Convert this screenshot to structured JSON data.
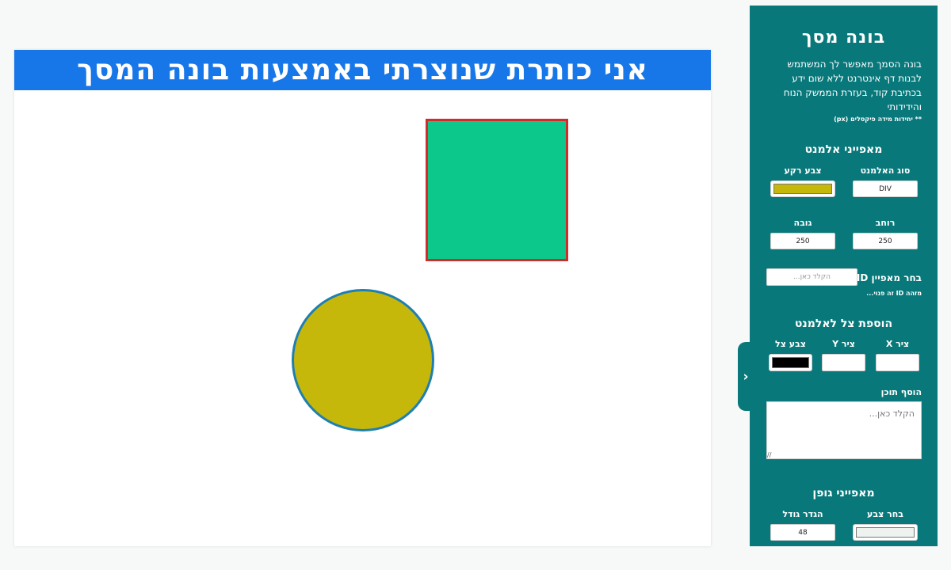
{
  "stage": {
    "title": "אני כותרת שנוצרתי באמצעות בונה המסך",
    "elements": [
      {
        "type": "square",
        "background": "#0cc98b",
        "border": "#d12b2b"
      },
      {
        "type": "circle",
        "background": "#c5b80b",
        "border": "#1e7fb0"
      }
    ]
  },
  "panel": {
    "title": "בונה מסך",
    "description": "בונה הסמך מאפשר לך המשתמש לבנות דף אינטרנט ללא שום ידע בכתיבת קוד, בעזרת הממשק הנוח והידידותי",
    "unit_note": "** יחידות מידה פיקסלים (px)",
    "element_props": {
      "title": "מאפייני אלמנט",
      "type_label": "סוג האלמנט",
      "type_value": "DIV",
      "bg_label": "צבע רקע",
      "bg_color": "#c5b80b",
      "width_label": "רוחב",
      "width_value": "250",
      "height_label": "גובה",
      "height_value": "250",
      "id_label": "בחר מאפיין ID",
      "id_placeholder": "הקלד כאן...",
      "id_note": "מזהה ID זה פנוי..."
    },
    "shadow": {
      "title": "הוספת צל לאלמנט",
      "x_label": "ציר X",
      "y_label": "ציר Y",
      "color_label": "צבע צל",
      "color": "#000000"
    },
    "content": {
      "label": "הוסף תוכן",
      "placeholder": "הקלד כאן..."
    },
    "font": {
      "title": "מאפייני גופן",
      "color_label": "בחר צבע",
      "color": "#eef3f0",
      "size_label": "הגדר גודל",
      "size_value": "48"
    }
  },
  "toggle_icon": "chevron-right-icon"
}
